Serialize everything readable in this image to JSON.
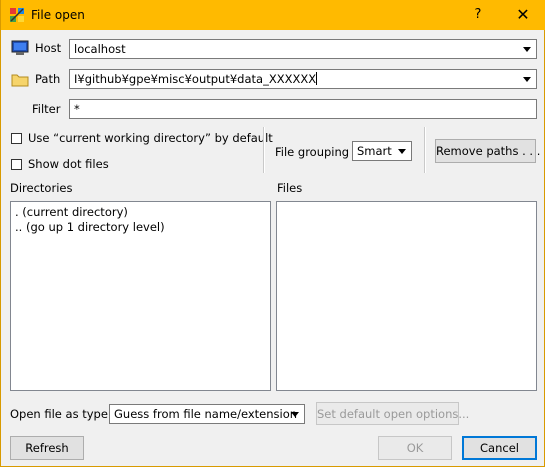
{
  "window": {
    "title": "File open",
    "help_label": "?",
    "close_label": "✕"
  },
  "host": {
    "label": "Host",
    "value": "localhost",
    "icon": "computer-icon"
  },
  "path": {
    "label": "Path",
    "value": "I¥github¥gpe¥misc¥output¥data_XXXXXX",
    "icon": "folder-icon"
  },
  "filter": {
    "label": "Filter",
    "value": "*"
  },
  "options": {
    "use_cwd_label": "Use “current working directory” by default",
    "show_dot_label": "Show dot files",
    "file_grouping_label": "File grouping",
    "file_grouping_value": "Smart",
    "remove_paths_label": "Remove paths . . ."
  },
  "directories": {
    "header": "Directories",
    "items": [
      ". (current directory)",
      ".. (go up 1 directory level)"
    ]
  },
  "files": {
    "header": "Files",
    "items": []
  },
  "open_as": {
    "label": "Open file as type:",
    "value": "Guess from file name/extension",
    "set_default_label": "Set default open options..."
  },
  "buttons": {
    "refresh": "Refresh",
    "ok": "OK",
    "cancel": "Cancel"
  },
  "colors": {
    "titlebar": "#ffba00",
    "focus_border": "#0078d7"
  }
}
